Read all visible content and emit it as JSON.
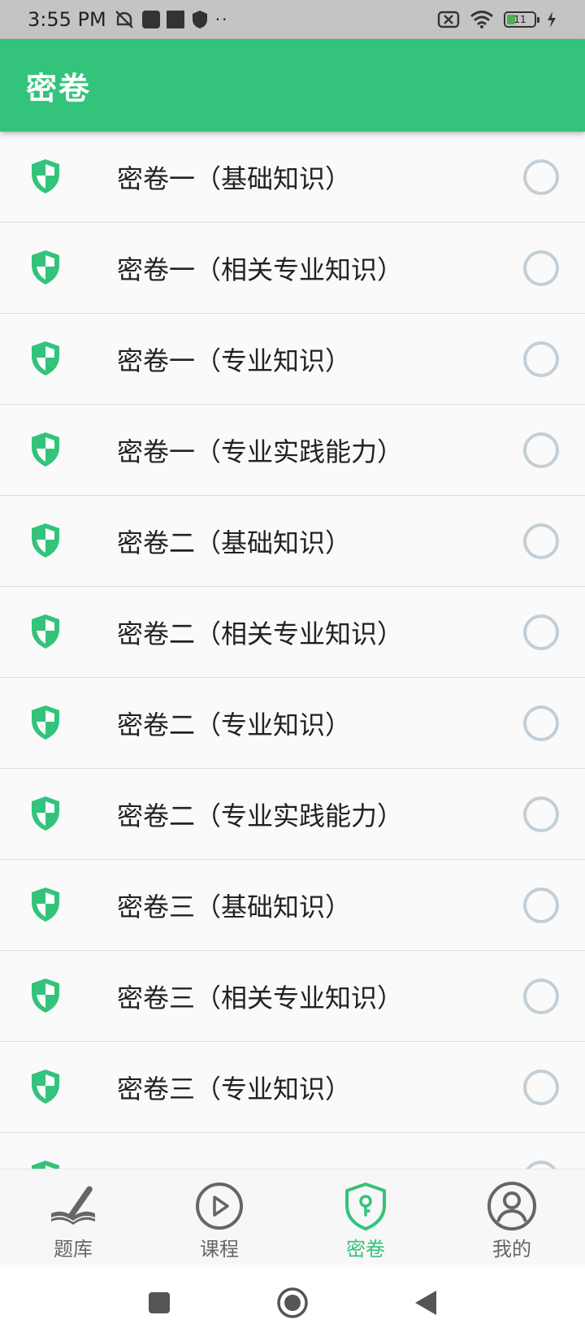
{
  "status_bar": {
    "time": "3:55 PM",
    "battery": "11",
    "icons": [
      "mute-icon",
      "app-icon",
      "app-square-icon",
      "shield-icon",
      "more-dots-icon",
      "no-sim-icon",
      "wifi-icon",
      "battery-icon",
      "charging-icon"
    ]
  },
  "app_bar": {
    "title": "密卷"
  },
  "list": {
    "items": [
      {
        "label": "密卷一（基础知识）"
      },
      {
        "label": "密卷一（相关专业知识）"
      },
      {
        "label": "密卷一（专业知识）"
      },
      {
        "label": "密卷一（专业实践能力）"
      },
      {
        "label": "密卷二（基础知识）"
      },
      {
        "label": "密卷二（相关专业知识）"
      },
      {
        "label": "密卷二（专业知识）"
      },
      {
        "label": "密卷二（专业实践能力）"
      },
      {
        "label": "密卷三（基础知识）"
      },
      {
        "label": "密卷三（相关专业知识）"
      },
      {
        "label": "密卷三（专业知识）"
      }
    ]
  },
  "bottom_nav": {
    "tabs": [
      {
        "label": "题库",
        "icon": "book-pen-icon",
        "active": false
      },
      {
        "label": "课程",
        "icon": "play-circle-icon",
        "active": false
      },
      {
        "label": "密卷",
        "icon": "shield-key-icon",
        "active": true
      },
      {
        "label": "我的",
        "icon": "user-icon",
        "active": false
      }
    ]
  },
  "colors": {
    "accent": "#33c37b",
    "radio": "#c3ced6",
    "status_bar": "#c4c4c4"
  }
}
